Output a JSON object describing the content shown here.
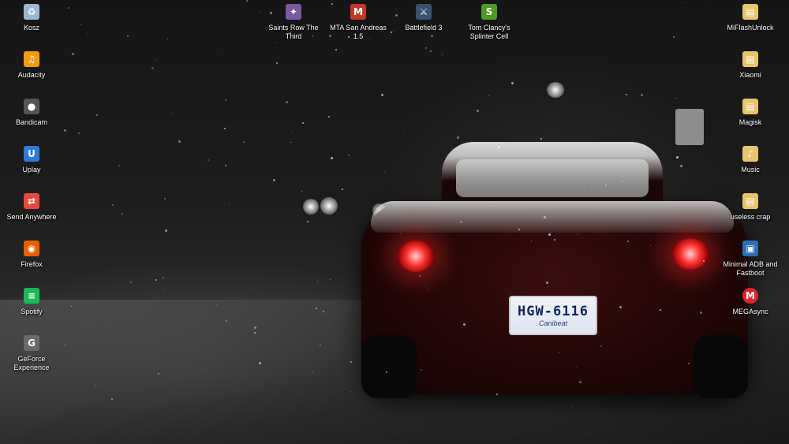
{
  "desktop": {
    "left_column": [
      {
        "label": "Kosz",
        "icon": "recycle-bin-icon",
        "color": "#9bb7d4",
        "glyph": "♻"
      },
      {
        "label": "Audacity",
        "icon": "audacity-icon",
        "color": "#f39c12",
        "glyph": "♫"
      },
      {
        "label": "Bandicam",
        "icon": "bandicam-icon",
        "color": "#555555",
        "glyph": "●"
      },
      {
        "label": "Uplay",
        "icon": "uplay-icon",
        "color": "#2f7ad9",
        "glyph": "U"
      },
      {
        "label": "Send Anywhere",
        "icon": "send-anywhere-icon",
        "color": "#e9473f",
        "glyph": "⇄"
      },
      {
        "label": "Firefox",
        "icon": "firefox-icon",
        "color": "#e66000",
        "glyph": "◉"
      },
      {
        "label": "Spotify",
        "icon": "spotify-icon",
        "color": "#1db954",
        "glyph": "≡"
      },
      {
        "label": "GeForce Experience",
        "icon": "geforce-experience-icon",
        "color": "#6a6a6a",
        "glyph": "G"
      }
    ],
    "top_row": [
      {
        "label": "Saints Row The Third",
        "icon": "saints-row-icon",
        "color": "#7a5aa0",
        "glyph": "✦"
      },
      {
        "label": "MTA San Andreas 1.5",
        "icon": "mta-icon",
        "color": "#c0392b",
        "glyph": "M"
      },
      {
        "label": "Battlefield 3",
        "icon": "battlefield-icon",
        "color": "#3a5270",
        "glyph": "⚔"
      },
      {
        "label": "Tom Clancy's Splinter Cell",
        "icon": "splinter-cell-icon",
        "color": "#4e9a22",
        "glyph": "S"
      }
    ],
    "right_column": [
      {
        "label": "MiFlashUnlock",
        "icon": "folder-icon",
        "color": "#e8c46a",
        "glyph": "▤"
      },
      {
        "label": "Xiaomi",
        "icon": "folder-icon",
        "color": "#e8c46a",
        "glyph": "▤"
      },
      {
        "label": "Magisk",
        "icon": "folder-icon",
        "color": "#e8c46a",
        "glyph": "▤"
      },
      {
        "label": "Music",
        "icon": "folder-music-icon",
        "color": "#e8c46a",
        "glyph": "♪"
      },
      {
        "label": "useless crap",
        "icon": "folder-icon",
        "color": "#e8c46a",
        "glyph": "▤"
      },
      {
        "label": "Minimal ADB and Fastboot",
        "icon": "adb-icon",
        "color": "#2d6fb3",
        "glyph": "▣"
      },
      {
        "label": "MEGAsync",
        "icon": "megasync-icon",
        "color": "#d9272e",
        "glyph": "M"
      }
    ]
  },
  "wallpaper": {
    "plate_number": "HGW-6116",
    "plate_frame": "Canibeat"
  }
}
